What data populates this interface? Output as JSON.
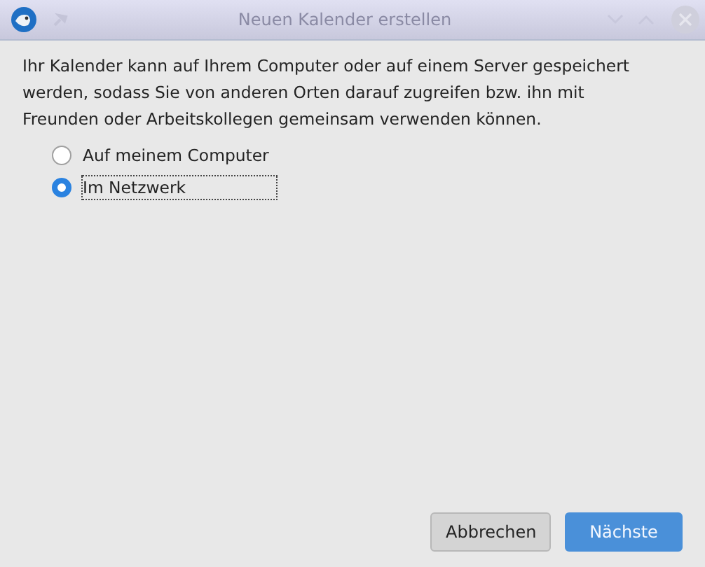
{
  "window": {
    "title": "Neuen Kalender erstellen"
  },
  "description": "Ihr Kalender kann auf Ihrem Computer oder auf einem Server gespeichert werden, sodass Sie von anderen Orten darauf zugreifen bzw. ihn mit Freunden oder Arbeitskollegen gemeinsam verwenden können.",
  "options": [
    {
      "label": "Auf meinem Computer",
      "selected": false,
      "focused": false
    },
    {
      "label": "Im Netzwerk",
      "selected": true,
      "focused": true
    }
  ],
  "buttons": [
    {
      "label": "Abbrechen",
      "kind": "secondary"
    },
    {
      "label": "Nächste",
      "kind": "primary"
    }
  ]
}
